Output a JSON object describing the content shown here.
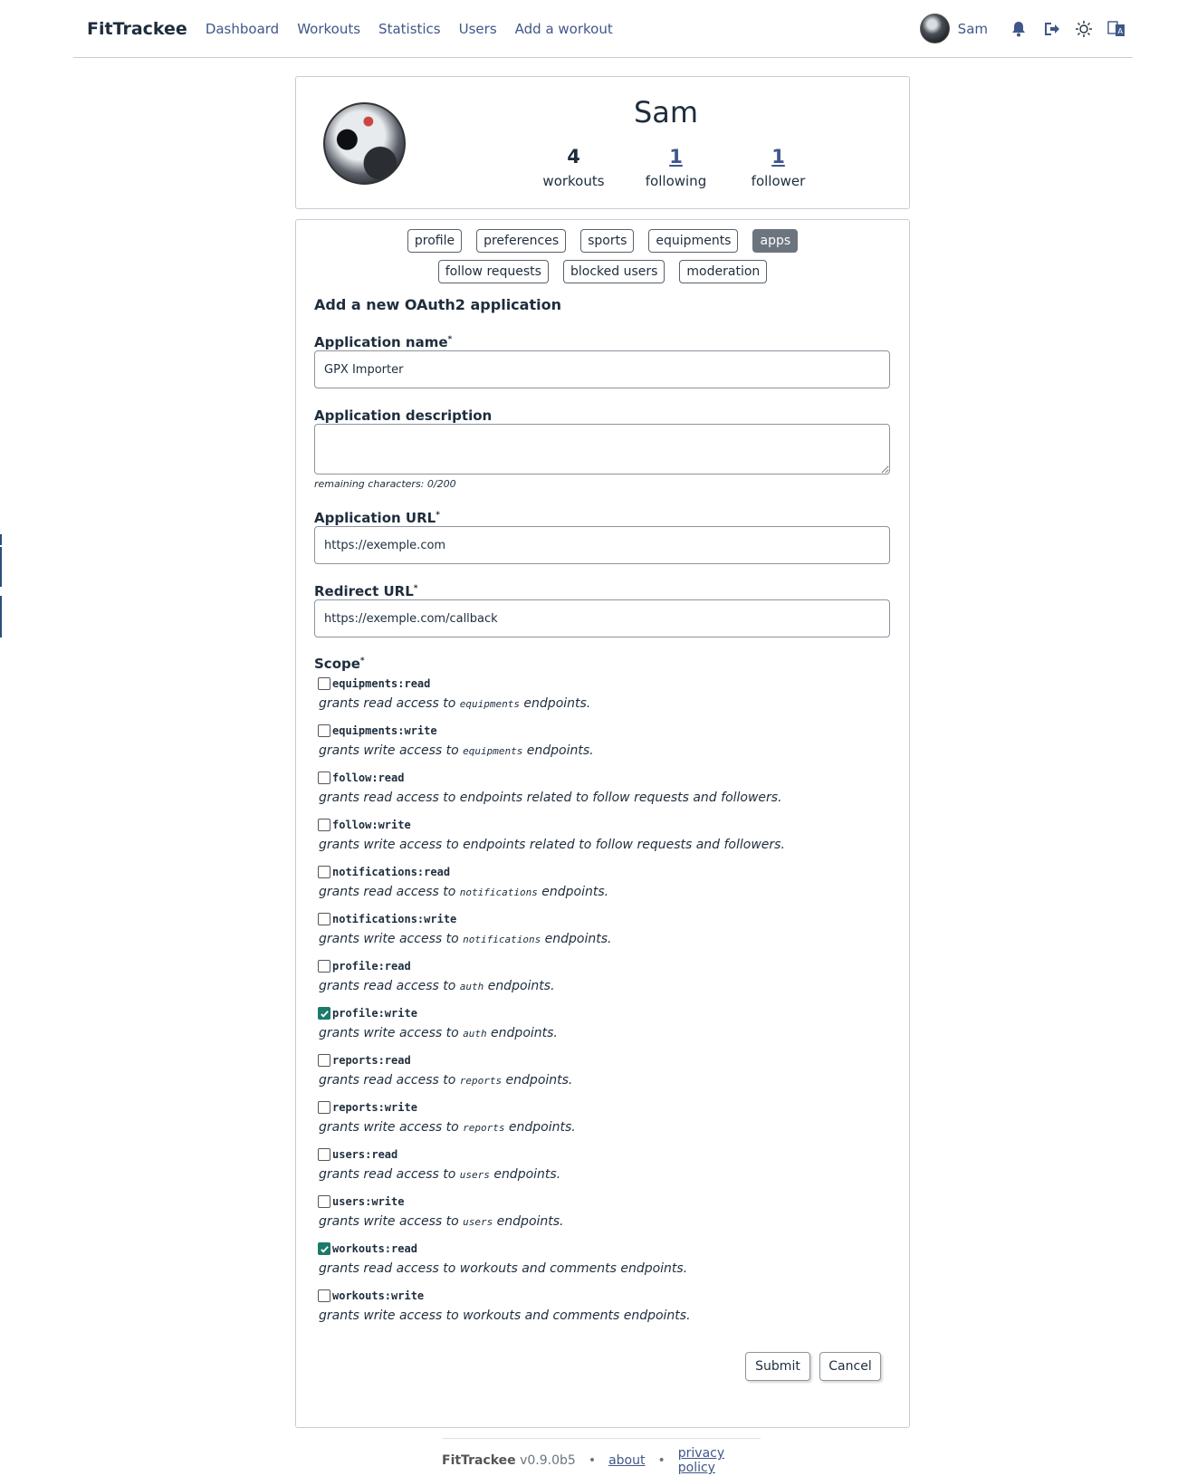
{
  "app": {
    "brand": "FitTrackee",
    "username": "Sam"
  },
  "nav": {
    "links": [
      "Dashboard",
      "Workouts",
      "Statistics",
      "Users",
      "Add a workout"
    ],
    "icons": [
      "bell-icon",
      "logout-icon",
      "sun-icon",
      "language-icon"
    ]
  },
  "profile": {
    "name": "Sam",
    "stats": [
      {
        "value": "4",
        "label": "workouts"
      },
      {
        "value": "1",
        "label": "following"
      },
      {
        "value": "1",
        "label": "follower"
      }
    ]
  },
  "tabs": {
    "row1": [
      "profile",
      "preferences",
      "sports",
      "equipments",
      "apps"
    ],
    "row2": [
      "follow requests",
      "blocked users",
      "moderation"
    ],
    "active": "apps"
  },
  "form": {
    "title": "Add a new OAuth2 application",
    "name_label": "Application name",
    "name_value": "GPX Importer",
    "description_label": "Application description",
    "description_value": "",
    "remaining": "remaining characters: 0/200",
    "url_label": "Application URL",
    "url_value": "https://exemple.com",
    "redirect_label": "Redirect URL",
    "redirect_value": "https://exemple.com/callback",
    "required_mark": "*",
    "scope_label": "Scope",
    "scopes": [
      {
        "name": "equipments:read",
        "checked": false,
        "pre": "grants read access to ",
        "code": "equipments",
        "post": " endpoints."
      },
      {
        "name": "equipments:write",
        "checked": false,
        "pre": "grants write access to ",
        "code": "equipments",
        "post": " endpoints."
      },
      {
        "name": "follow:read",
        "checked": false,
        "pre": "grants read access to endpoints related to follow requests and followers.",
        "code": "",
        "post": ""
      },
      {
        "name": "follow:write",
        "checked": false,
        "pre": "grants write access to endpoints related to follow requests and followers.",
        "code": "",
        "post": ""
      },
      {
        "name": "notifications:read",
        "checked": false,
        "pre": "grants read access to ",
        "code": "notifications",
        "post": " endpoints."
      },
      {
        "name": "notifications:write",
        "checked": false,
        "pre": "grants write access to ",
        "code": "notifications",
        "post": " endpoints."
      },
      {
        "name": "profile:read",
        "checked": false,
        "pre": "grants read access to ",
        "code": "auth",
        "post": " endpoints."
      },
      {
        "name": "profile:write",
        "checked": true,
        "pre": "grants write access to ",
        "code": "auth",
        "post": " endpoints."
      },
      {
        "name": "reports:read",
        "checked": false,
        "pre": "grants read access to ",
        "code": "reports",
        "post": " endpoints."
      },
      {
        "name": "reports:write",
        "checked": false,
        "pre": "grants write access to ",
        "code": "reports",
        "post": " endpoints."
      },
      {
        "name": "users:read",
        "checked": false,
        "pre": "grants read access to ",
        "code": "users",
        "post": " endpoints."
      },
      {
        "name": "users:write",
        "checked": false,
        "pre": "grants write access to ",
        "code": "users",
        "post": " endpoints."
      },
      {
        "name": "workouts:read",
        "checked": true,
        "pre": "grants read access to workouts and comments endpoints.",
        "code": "",
        "post": ""
      },
      {
        "name": "workouts:write",
        "checked": false,
        "pre": "grants write access to workouts and comments endpoints.",
        "code": "",
        "post": ""
      }
    ],
    "submit_label": "Submit",
    "cancel_label": "Cancel"
  },
  "footer": {
    "brand": "FitTrackee",
    "version": "v0.9.0b5",
    "separator": "•",
    "about": "about",
    "privacy": "privacy policy"
  },
  "colors": {
    "link": "#40578a",
    "checked": "#1c7a6a",
    "active_tab": "#6c757d"
  }
}
